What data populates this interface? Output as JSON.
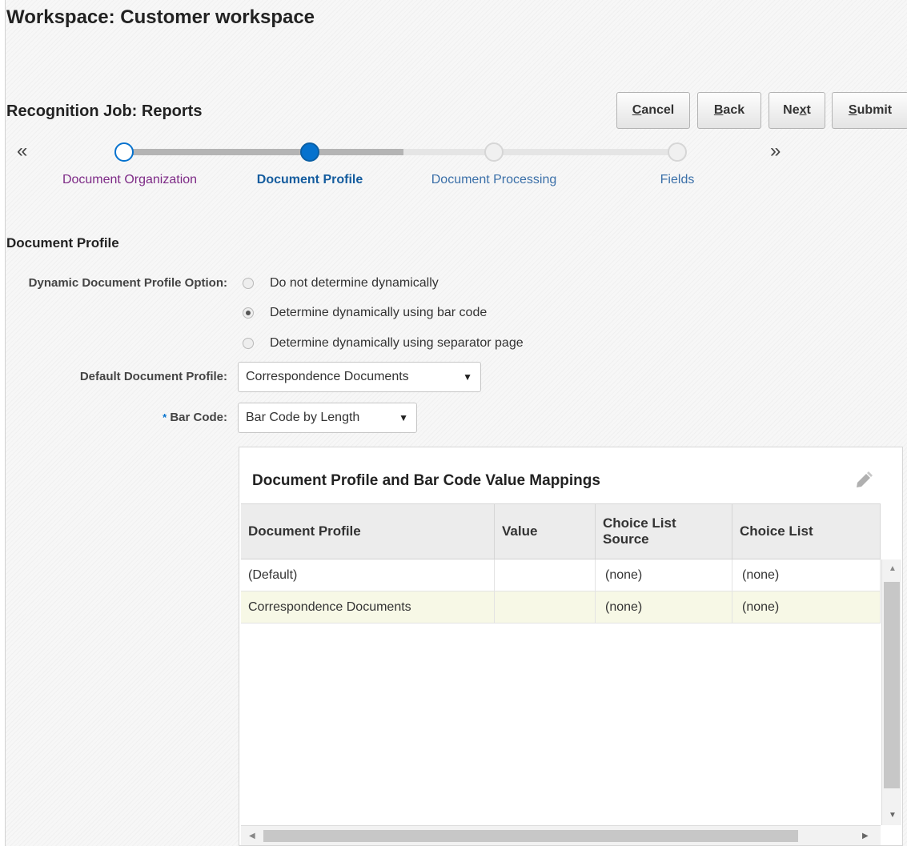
{
  "workspace": {
    "title": "Workspace: Customer workspace"
  },
  "job": {
    "title": "Recognition Job: Reports"
  },
  "toolbar": {
    "cancel": {
      "accel": "C",
      "rest": "ancel"
    },
    "back": {
      "accel": "B",
      "rest": "ack"
    },
    "next": {
      "pre": "Ne",
      "accel": "x",
      "rest": "t"
    },
    "submit": {
      "accel": "S",
      "rest": "ubmit"
    }
  },
  "train": {
    "prev": "«",
    "next": "»",
    "stops": [
      {
        "label": "Document Organization",
        "state": "visited"
      },
      {
        "label": "Document Profile",
        "state": "current"
      },
      {
        "label": "Document Processing",
        "state": "unvisited"
      },
      {
        "label": "Fields",
        "state": "unvisited"
      }
    ]
  },
  "section": {
    "title": "Document Profile"
  },
  "form": {
    "dynamic_label": "Dynamic Document Profile Option:",
    "dynamic_options": [
      {
        "label": "Do not determine dynamically",
        "selected": false
      },
      {
        "label": "Determine dynamically using bar code",
        "selected": true
      },
      {
        "label": "Determine dynamically using separator page",
        "selected": false
      }
    ],
    "default_profile_label": "Default Document Profile:",
    "default_profile_value": "Correspondence Documents",
    "barcode_required_mark": "*",
    "barcode_label": "Bar Code:",
    "barcode_value": "Bar Code by Length",
    "dropdown_glyph": "▼"
  },
  "mappings": {
    "title": "Document Profile and Bar Code Value Mappings",
    "columns": [
      "Document Profile",
      "Value",
      "Choice List Source",
      "Choice List"
    ],
    "rows": [
      [
        "(Default)",
        "",
        "(none)",
        "(none)"
      ],
      [
        "Correspondence Documents",
        "",
        "(none)",
        "(none)"
      ]
    ]
  },
  "colors": {
    "accent": "#0572ce",
    "visited_link": "#7d2a86",
    "selected_row": "#f7f8e6"
  }
}
